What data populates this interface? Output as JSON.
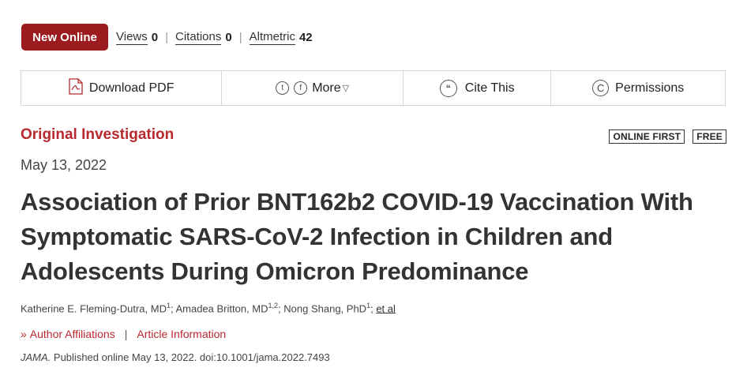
{
  "header": {
    "badge": "New Online",
    "metrics": [
      {
        "label": "Views",
        "value": "0"
      },
      {
        "label": "Citations",
        "value": "0"
      },
      {
        "label": "Altmetric",
        "value": "42"
      }
    ]
  },
  "toolbar": {
    "download": "Download PDF",
    "more": "More",
    "cite": "Cite This",
    "permissions": "Permissions",
    "icons": {
      "pdf": "pdf-icon",
      "twitter": "twitter-icon",
      "facebook": "facebook-icon",
      "quote": "quote-icon",
      "copyright": "copyright-icon"
    },
    "glyphs": {
      "twitter": "t",
      "facebook": "f",
      "quote": "“",
      "copyright": "C",
      "dropdown": "▽"
    }
  },
  "article": {
    "category": "Original Investigation",
    "badges": [
      "ONLINE FIRST",
      "FREE"
    ],
    "date": "May 13, 2022",
    "title": "Association of Prior BNT162b2 COVID-19 Vaccination With Symptomatic SARS-CoV-2 Infection in Children and Adolescents During Omicron Predominance",
    "authors": [
      {
        "name": "Katherine E. Fleming-Dutra, MD",
        "sup": "1",
        "sep": "; "
      },
      {
        "name": "Amadea Britton, MD",
        "sup": "1,2",
        "sep": "; "
      },
      {
        "name": "Nong Shang, PhD",
        "sup": "1",
        "sep": "; "
      }
    ],
    "et_al": "et al",
    "links": {
      "affiliations": "Author Affiliations",
      "separator": "|",
      "info": "Article Information",
      "chevron": "»"
    },
    "citation": {
      "journal": "JAMA.",
      "text": " Published online May 13, 2022. doi:10.1001/jama.2022.7493"
    }
  },
  "colors": {
    "brand": "#9b1b1f",
    "accent": "#b8292f"
  }
}
